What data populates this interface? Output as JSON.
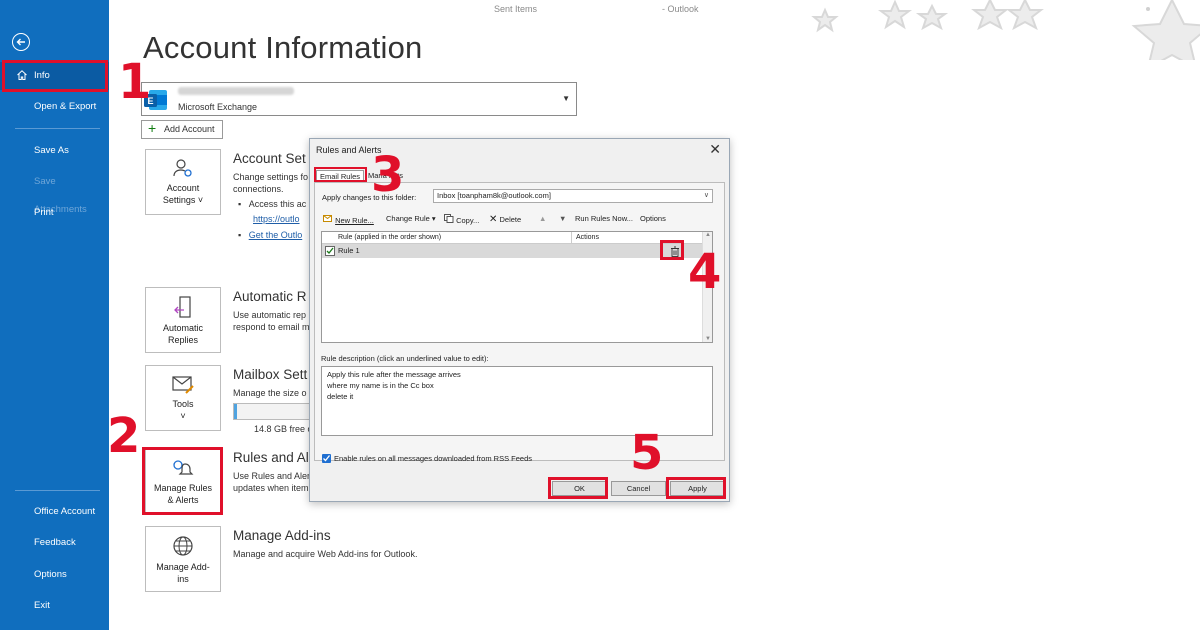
{
  "colors": {
    "sidebar": "#106ebe",
    "highlight": "#e0102a",
    "link": "#1f5ea8"
  },
  "topbar": {
    "folder": "Sent Items",
    "app": "-  Outlook"
  },
  "sidebar": {
    "items": [
      {
        "label": "Info"
      },
      {
        "label": "Open & Export"
      },
      {
        "label": "Save As"
      },
      {
        "label": "Save Attachments"
      },
      {
        "label": "Print"
      },
      {
        "label": "Office Account"
      },
      {
        "label": "Feedback"
      },
      {
        "label": "Options"
      },
      {
        "label": "Exit"
      }
    ]
  },
  "main": {
    "title": "Account Information",
    "account_type": "Microsoft Exchange",
    "add_account": "Add Account",
    "tiles": {
      "account_settings": [
        "Account",
        "Settings ˅"
      ],
      "automatic_replies": [
        "Automatic",
        "Replies"
      ],
      "tools": [
        "Tools",
        "˅"
      ],
      "manage_rules": [
        "Manage Rules",
        "& Alerts"
      ],
      "manage_addins": [
        "Manage Add-",
        "ins"
      ]
    },
    "sections": {
      "account_settings": {
        "title": "Account Set",
        "text1": "Change settings fo",
        "text2": "connections.",
        "bullet1": "Access this ac",
        "link1": "https://outlo",
        "link2": "Get the Outlo"
      },
      "automatic_replies": {
        "title": "Automatic R",
        "text1": "Use automatic rep",
        "text2": "respond to email m"
      },
      "mailbox": {
        "title": "Mailbox Sett",
        "text1": "Manage the size o",
        "free": "14.8 GB free o",
        "usage_fraction": 0.04
      },
      "rules": {
        "title": "Rules and Al",
        "text1": "Use Rules and Aler",
        "text2": "updates when item"
      },
      "addins": {
        "title": "Manage Add-ins",
        "text1": "Manage and acquire Web Add-ins for Outlook."
      }
    }
  },
  "dialog": {
    "title": "Rules and Alerts",
    "tabs": {
      "email_rules": "Email Rules",
      "manage_alerts": "Mana      lerts"
    },
    "folder_label": "Apply changes to this folder:",
    "folder_value": "Inbox [toanpham8k@outlook.com]",
    "toolbar": {
      "new_rule": "New Rule...",
      "change_rule": "Change Rule ▾",
      "copy": "Copy...",
      "delete": "Delete",
      "run_rules": "Run Rules Now...",
      "options": "Options"
    },
    "columns": {
      "rule": "Rule (applied in the order shown)",
      "actions": "Actions"
    },
    "rows": [
      {
        "name": "Rule 1",
        "checked": true
      }
    ],
    "description_label": "Rule description (click an underlined value to edit):",
    "description_lines": [
      "Apply this rule after the message arrives",
      "where my name is in the Cc box",
      "delete it"
    ],
    "rss_label": "Enable rules on all messages downloaded from RSS Feeds",
    "buttons": {
      "ok": "OK",
      "cancel": "Cancel",
      "apply": "Apply"
    }
  },
  "steps": [
    "1",
    "2",
    "3",
    "4",
    "5"
  ]
}
